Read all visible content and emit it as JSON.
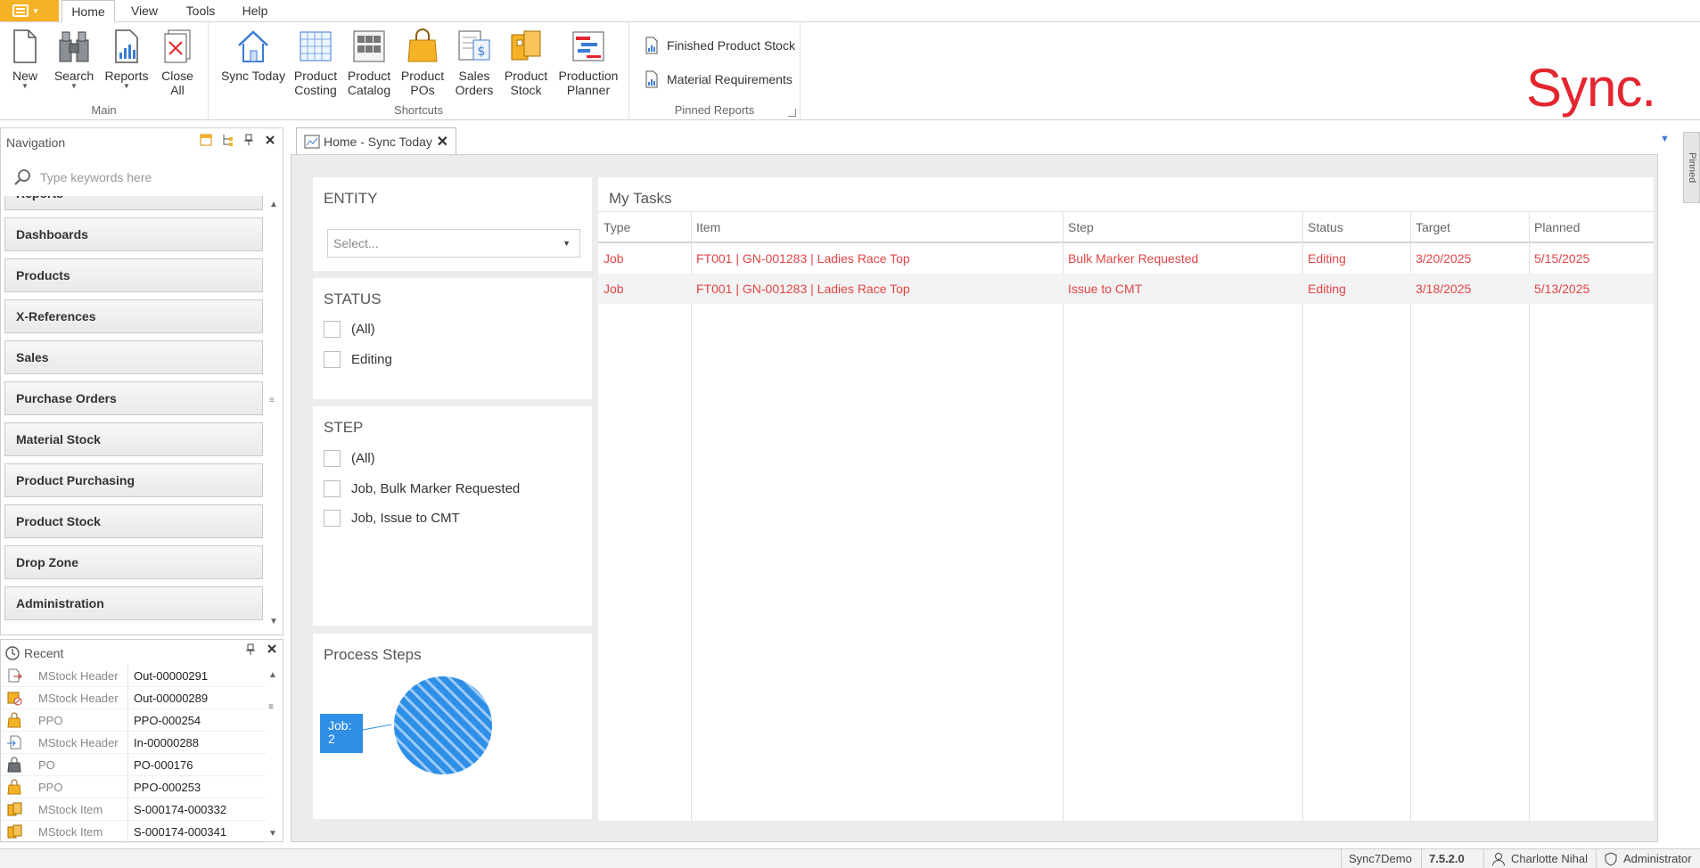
{
  "menubar": {
    "tabs": [
      {
        "label": "Home",
        "active": true
      },
      {
        "label": "View"
      },
      {
        "label": "Tools"
      },
      {
        "label": "Help"
      }
    ]
  },
  "ribbon": {
    "main": {
      "label": "Main",
      "buttons": [
        {
          "label": "New",
          "icon": "new-document-icon"
        },
        {
          "label": "Search",
          "icon": "binoculars-icon"
        },
        {
          "label": "Reports",
          "icon": "report-icon"
        },
        {
          "label1": "Close",
          "label2": "All",
          "icon": "close-all-icon"
        }
      ]
    },
    "shortcuts": {
      "label": "Shortcuts",
      "buttons": [
        {
          "label1": "Sync Today",
          "label2": "",
          "icon": "home-icon"
        },
        {
          "label1": "Product",
          "label2": "Costing",
          "icon": "costing-grid-icon"
        },
        {
          "label1": "Product",
          "label2": "Catalog",
          "icon": "catalog-icon"
        },
        {
          "label1": "Product",
          "label2": "POs",
          "icon": "shopping-bag-icon"
        },
        {
          "label1": "Sales",
          "label2": "Orders",
          "icon": "sales-orders-icon"
        },
        {
          "label1": "Product",
          "label2": "Stock",
          "icon": "stock-boxes-icon"
        },
        {
          "label1": "Production",
          "label2": "Planner",
          "icon": "planner-icon"
        }
      ]
    },
    "pinned_reports": {
      "label": "Pinned Reports",
      "links": [
        "Finished Product Stock",
        "Material Requirements"
      ]
    },
    "logo": "Sync."
  },
  "navigation": {
    "title": "Navigation",
    "search_placeholder": "Type keywords here",
    "items": [
      "Reports",
      "Dashboards",
      "Products",
      "X-References",
      "Sales",
      "Purchase Orders",
      "Material Stock",
      "Product Purchasing",
      "Product Stock",
      "Drop Zone",
      "Administration"
    ]
  },
  "recent": {
    "title": "Recent",
    "rows": [
      {
        "type": "MStock Header",
        "ref": "Out-00000291",
        "icon": "stock-out-icon"
      },
      {
        "type": "MStock Header",
        "ref": "Out-00000289",
        "icon": "stock-cancel-icon"
      },
      {
        "type": "PPO",
        "ref": "PPO-000254",
        "icon": "shopping-bag-icon"
      },
      {
        "type": "MStock Header",
        "ref": "In-00000288",
        "icon": "stock-in-icon"
      },
      {
        "type": "PO",
        "ref": "PO-000176",
        "icon": "locked-bag-icon"
      },
      {
        "type": "PPO",
        "ref": "PPO-000253",
        "icon": "shopping-bag-icon"
      },
      {
        "type": "MStock Item",
        "ref": "S-000174-000332",
        "icon": "stock-item-icon"
      },
      {
        "type": "MStock Item",
        "ref": "S-000174-000341",
        "icon": "stock-item-icon"
      }
    ]
  },
  "document_tab": {
    "title": "Home - Sync Today"
  },
  "pinned_strip_label": "Pinned",
  "entity": {
    "title": "ENTITY",
    "select_placeholder": "Select..."
  },
  "status_filter": {
    "title": "STATUS",
    "options": [
      "(All)",
      "Editing"
    ]
  },
  "step_filter": {
    "title": "STEP",
    "options": [
      "(All)",
      "Job, Bulk Marker Requested",
      "Job, Issue to CMT"
    ]
  },
  "process_steps": {
    "title": "Process Steps",
    "node_label_line1": "Job:",
    "node_label_line2": "2",
    "node_color": "#2f8fe6"
  },
  "tasks": {
    "title": "My Tasks",
    "columns": [
      "Type",
      "Item",
      "Step",
      "Status",
      "Target",
      "Planned"
    ],
    "rows": [
      {
        "type": "Job",
        "item": "FT001 | GN-001283 | Ladies Race Top",
        "step": "Bulk Marker Requested",
        "status": "Editing",
        "target": "3/20/2025",
        "planned": "5/15/2025"
      },
      {
        "type": "Job",
        "item": "FT001 | GN-001283 | Ladies Race Top",
        "step": "Issue to CMT",
        "status": "Editing",
        "target": "3/18/2025",
        "planned": "5/13/2025"
      }
    ],
    "row_color": "#e04545"
  },
  "statusbar": {
    "database": "Sync7Demo",
    "version": "7.5.2.0",
    "user": "Charlotte Nihal",
    "role": "Administrator"
  }
}
